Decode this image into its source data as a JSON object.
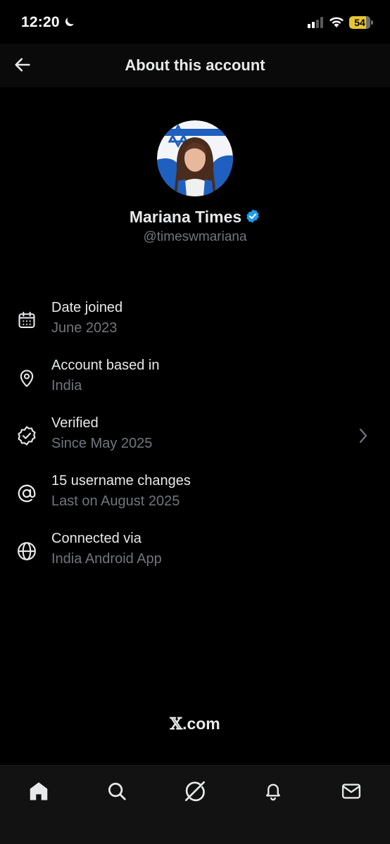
{
  "status_bar": {
    "time": "12:20",
    "battery": "54",
    "icons": [
      "moon-icon",
      "signal-icon",
      "wifi-icon",
      "battery-icon"
    ]
  },
  "header": {
    "title": "About this account",
    "back_icon": "arrow-left-icon"
  },
  "profile": {
    "name": "Mariana Times",
    "handle": "@timeswmariana",
    "verified": true,
    "badge_color": "#1d9bf0"
  },
  "info": [
    {
      "icon": "calendar-icon",
      "title": "Date joined",
      "subtitle": "June 2023"
    },
    {
      "icon": "location-pin-icon",
      "title": "Account based in",
      "subtitle": "India"
    },
    {
      "icon": "verified-badge-icon",
      "title": "Verified",
      "subtitle": "Since May 2025"
    },
    {
      "icon": "at-sign-icon",
      "title": "15 username changes",
      "subtitle": "Last on August 2025"
    },
    {
      "icon": "globe-icon",
      "title": "Connected via",
      "subtitle": "India Android App"
    }
  ],
  "footer": {
    "brand_mark": "𝕏",
    "brand_suffix": ".com"
  },
  "bottom_nav": [
    "home-icon",
    "search-icon",
    "grok-icon",
    "notifications-icon",
    "messages-icon"
  ],
  "colors": {
    "background": "#000000",
    "text_primary": "#e7e9ea",
    "text_secondary": "#71767b",
    "accent": "#1d9bf0",
    "battery": "#e7c532"
  }
}
